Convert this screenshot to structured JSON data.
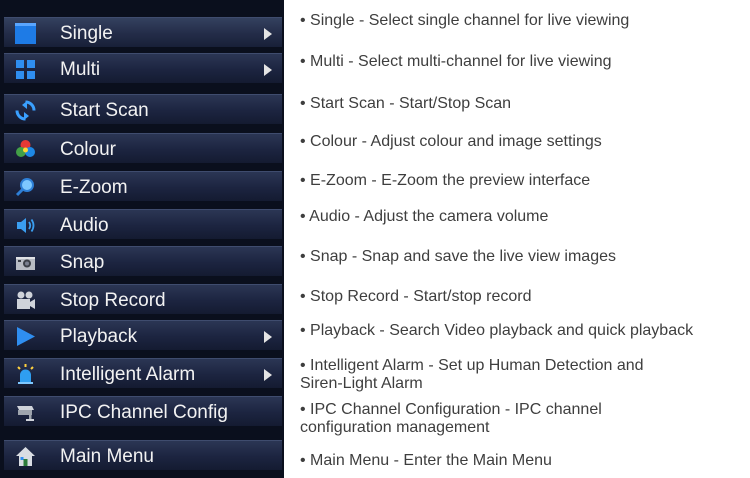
{
  "menu": {
    "items": [
      {
        "label": "Single",
        "icon": "square-icon",
        "submenu": true
      },
      {
        "label": "Multi",
        "icon": "grid-icon",
        "submenu": true
      },
      {
        "label": "Start Scan",
        "icon": "scan-icon",
        "submenu": false
      },
      {
        "label": "Colour",
        "icon": "color-wheel-icon",
        "submenu": false
      },
      {
        "label": "E-Zoom",
        "icon": "magnifier-icon",
        "submenu": false
      },
      {
        "label": "Audio",
        "icon": "speaker-icon",
        "submenu": false
      },
      {
        "label": "Snap",
        "icon": "camera-icon",
        "submenu": false
      },
      {
        "label": "Stop Record",
        "icon": "record-icon",
        "submenu": false
      },
      {
        "label": "Playback",
        "icon": "play-icon",
        "submenu": true
      },
      {
        "label": "Intelligent Alarm",
        "icon": "alarm-light-icon",
        "submenu": true
      },
      {
        "label": "IPC Channel Config",
        "icon": "ip-camera-icon",
        "submenu": false
      },
      {
        "label": "Main Menu",
        "icon": "home-icon",
        "submenu": false
      }
    ]
  },
  "descriptions": [
    {
      "lines": [
        "• Single - Select single channel for live viewing"
      ]
    },
    {
      "lines": [
        "• Multi - Select multi-channel for live viewing"
      ]
    },
    {
      "lines": [
        "• Start Scan - Start/Stop Scan"
      ]
    },
    {
      "lines": [
        "• Colour - Adjust colour and image settings"
      ]
    },
    {
      "lines": [
        "• E-Zoom - E-Zoom the preview interface"
      ]
    },
    {
      "lines": [
        "• Audio - Adjust the camera volume"
      ]
    },
    {
      "lines": [
        "• Snap - Snap and save the live view images"
      ]
    },
    {
      "lines": [
        "• Stop Record - Start/stop record"
      ]
    },
    {
      "lines": [
        "• Playback - Search Video playback and quick playback"
      ]
    },
    {
      "lines": [
        "• Intelligent Alarm - Set up Human Detection and",
        "Siren-Light Alarm"
      ]
    },
    {
      "lines": [
        "• IPC Channel Configuration - IPC channel",
        "configuration management"
      ]
    },
    {
      "lines": [
        "• Main Menu - Enter the Main Menu"
      ]
    }
  ],
  "colors": {
    "menu_bg": "#0a0f1d",
    "menu_text": "#f2f2f2",
    "desc_text": "#3e3e3e",
    "icon_blue": "#1e7be6"
  }
}
